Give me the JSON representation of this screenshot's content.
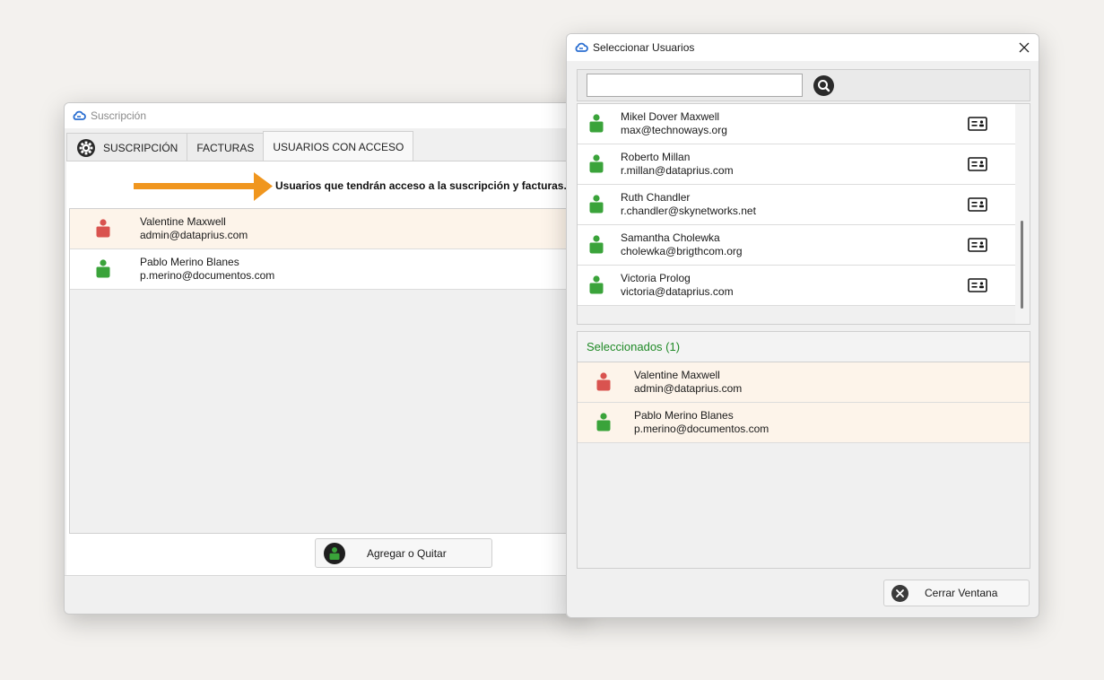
{
  "colors": {
    "admin_user": "#d9534f",
    "regular_user": "#3aa33a",
    "selected_header": "#1f8a26",
    "arrow": "#f0961e",
    "highlight_row": "#fdf4ea"
  },
  "back_window": {
    "title": "Suscripción",
    "tabs": [
      {
        "label": "SUSCRIPCIÓN",
        "icon": "gear-icon"
      },
      {
        "label": "FACTURAS"
      },
      {
        "label": "USUARIOS CON ACCESO",
        "active": true
      }
    ],
    "info_text": "Usuarios que tendrán acceso a la suscripción y facturas.",
    "users": [
      {
        "name": "Valentine Maxwell",
        "email": "admin@dataprius.com",
        "role": "admin",
        "highlighted": true
      },
      {
        "name": "Pablo Merino Blanes",
        "email": "p.merino@documentos.com",
        "role": "user",
        "highlighted": false
      }
    ],
    "add_remove_button": "Agregar o Quitar"
  },
  "dialog": {
    "title": "Seleccionar Usuarios",
    "search": {
      "value": "",
      "placeholder": ""
    },
    "results": [
      {
        "name": "Mikel Dover Maxwell",
        "email": "max@technoways.org"
      },
      {
        "name": "Roberto Millan",
        "email": "r.millan@dataprius.com"
      },
      {
        "name": "Ruth Chandler",
        "email": "r.chandler@skynetworks.net"
      },
      {
        "name": "Samantha Cholewka",
        "email": "cholewka@brigthcom.org"
      },
      {
        "name": "Victoria Prolog",
        "email": "victoria@dataprius.com"
      }
    ],
    "selected_header": "Seleccionados (1)",
    "selected": [
      {
        "name": "Valentine Maxwell",
        "email": "admin@dataprius.com",
        "role": "admin"
      },
      {
        "name": "Pablo Merino Blanes",
        "email": "p.merino@documentos.com",
        "role": "user"
      }
    ],
    "close_button": "Cerrar Ventana"
  }
}
